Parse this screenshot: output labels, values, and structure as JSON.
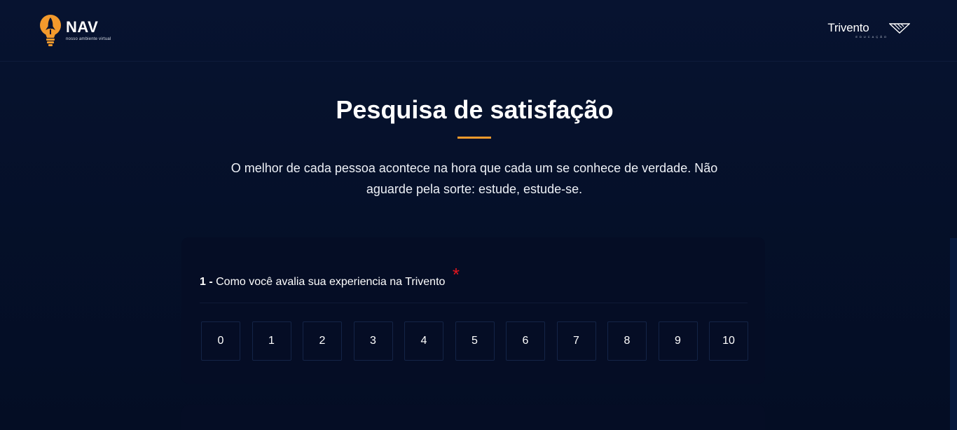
{
  "header": {
    "logo": {
      "name": "NAV",
      "tagline": "nosso ambiente virtual",
      "icon": "rocket-bulb-icon"
    },
    "partner": {
      "name": "Trivento",
      "sub": "EDUCAÇÃO",
      "icon": "trivento-mark-icon"
    }
  },
  "hero": {
    "title": "Pesquisa de satisfação",
    "subtitle": "O melhor de cada pessoa acontece na hora que cada um se conhece de verdade. Não aguarde pela sorte: estude, estude-se."
  },
  "survey": {
    "question_number": "1 -",
    "question_text": "Como você avalia sua experiencia na Trivento",
    "required_mark": "*",
    "options": [
      "0",
      "1",
      "2",
      "3",
      "4",
      "5",
      "6",
      "7",
      "8",
      "9",
      "10"
    ]
  },
  "colors": {
    "background": "#06112a",
    "card": "#050d25",
    "accent": "#f39a2c",
    "required": "#e3161f"
  }
}
